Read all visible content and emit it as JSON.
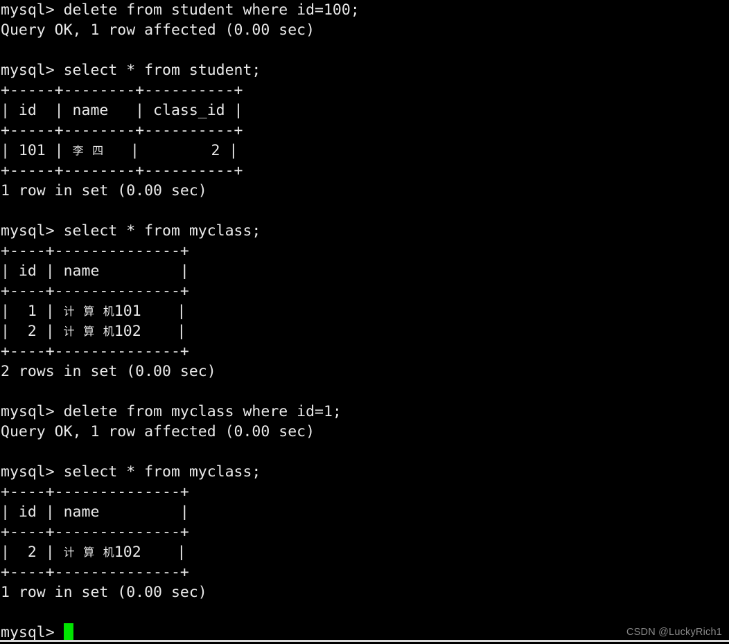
{
  "terminal": {
    "background_color": "#000000",
    "text_color": "#e9e9e9",
    "cursor_color": "#00e500",
    "prompt": "mysql> ",
    "lines": [
      {
        "id": "l01",
        "type": "prompt",
        "text": "mysql> delete from student where id=100;"
      },
      {
        "id": "l02",
        "type": "output",
        "text": "Query OK, 1 row affected (0.00 sec)"
      },
      {
        "id": "l03",
        "type": "blank",
        "text": ""
      },
      {
        "id": "l04",
        "type": "prompt",
        "text": "mysql> select * from student;"
      },
      {
        "id": "l05",
        "type": "output",
        "text": "+-----+--------+----------+"
      },
      {
        "id": "l06",
        "type": "output",
        "text": "| id  | name   | class_id |"
      },
      {
        "id": "l07",
        "type": "output",
        "text": "+-----+--------+----------+"
      },
      {
        "id": "l08",
        "type": "output-cjk",
        "pre": "| 101 | ",
        "cjk": "李四",
        "post": "   |        2 |"
      },
      {
        "id": "l09",
        "type": "output",
        "text": "+-----+--------+----------+"
      },
      {
        "id": "l10",
        "type": "output",
        "text": "1 row in set (0.00 sec)"
      },
      {
        "id": "l11",
        "type": "blank",
        "text": ""
      },
      {
        "id": "l12",
        "type": "prompt",
        "text": "mysql> select * from myclass;"
      },
      {
        "id": "l13",
        "type": "output",
        "text": "+----+--------------+"
      },
      {
        "id": "l14",
        "type": "output",
        "text": "| id | name         |"
      },
      {
        "id": "l15",
        "type": "output",
        "text": "+----+--------------+"
      },
      {
        "id": "l16",
        "type": "output-cjk",
        "pre": "|  1 | ",
        "cjk": "计算机",
        "post": "101    |"
      },
      {
        "id": "l17",
        "type": "output-cjk",
        "pre": "|  2 | ",
        "cjk": "计算机",
        "post": "102    |"
      },
      {
        "id": "l18",
        "type": "output",
        "text": "+----+--------------+"
      },
      {
        "id": "l19",
        "type": "output",
        "text": "2 rows in set (0.00 sec)"
      },
      {
        "id": "l20",
        "type": "blank",
        "text": ""
      },
      {
        "id": "l21",
        "type": "prompt",
        "text": "mysql> delete from myclass where id=1;"
      },
      {
        "id": "l22",
        "type": "output",
        "text": "Query OK, 1 row affected (0.00 sec)"
      },
      {
        "id": "l23",
        "type": "blank",
        "text": ""
      },
      {
        "id": "l24",
        "type": "prompt",
        "text": "mysql> select * from myclass;"
      },
      {
        "id": "l25",
        "type": "output",
        "text": "+----+--------------+"
      },
      {
        "id": "l26",
        "type": "output",
        "text": "| id | name         |"
      },
      {
        "id": "l27",
        "type": "output",
        "text": "+----+--------------+"
      },
      {
        "id": "l28",
        "type": "output-cjk",
        "pre": "|  2 | ",
        "cjk": "计算机",
        "post": "102    |"
      },
      {
        "id": "l29",
        "type": "output",
        "text": "+----+--------------+"
      },
      {
        "id": "l30",
        "type": "output",
        "text": "1 row in set (0.00 sec)"
      },
      {
        "id": "l31",
        "type": "blank",
        "text": ""
      },
      {
        "id": "l32",
        "type": "prompt-cursor",
        "text": "mysql> "
      }
    ],
    "queries": [
      {
        "sql": "delete from student where id=100;",
        "result": "Query OK, 1 row affected (0.00 sec)"
      },
      {
        "sql": "select * from student;",
        "result": "1 row in set (0.00 sec)"
      },
      {
        "sql": "select * from myclass;",
        "result": "2 rows in set (0.00 sec)"
      },
      {
        "sql": "delete from myclass where id=1;",
        "result": "Query OK, 1 row affected (0.00 sec)"
      },
      {
        "sql": "select * from myclass;",
        "result": "1 row in set (0.00 sec)"
      }
    ],
    "tables": [
      {
        "name": "student",
        "columns": [
          "id",
          "name",
          "class_id"
        ],
        "rows": [
          [
            "101",
            "李四",
            "2"
          ]
        ]
      },
      {
        "name": "myclass",
        "columns": [
          "id",
          "name"
        ],
        "rows": [
          [
            "1",
            "计算机101"
          ],
          [
            "2",
            "计算机102"
          ]
        ]
      },
      {
        "name": "myclass",
        "columns": [
          "id",
          "name"
        ],
        "rows": [
          [
            "2",
            "计算机102"
          ]
        ]
      }
    ]
  },
  "watermark": {
    "text": "CSDN @LuckyRich1",
    "color": "#8a8a8a"
  }
}
